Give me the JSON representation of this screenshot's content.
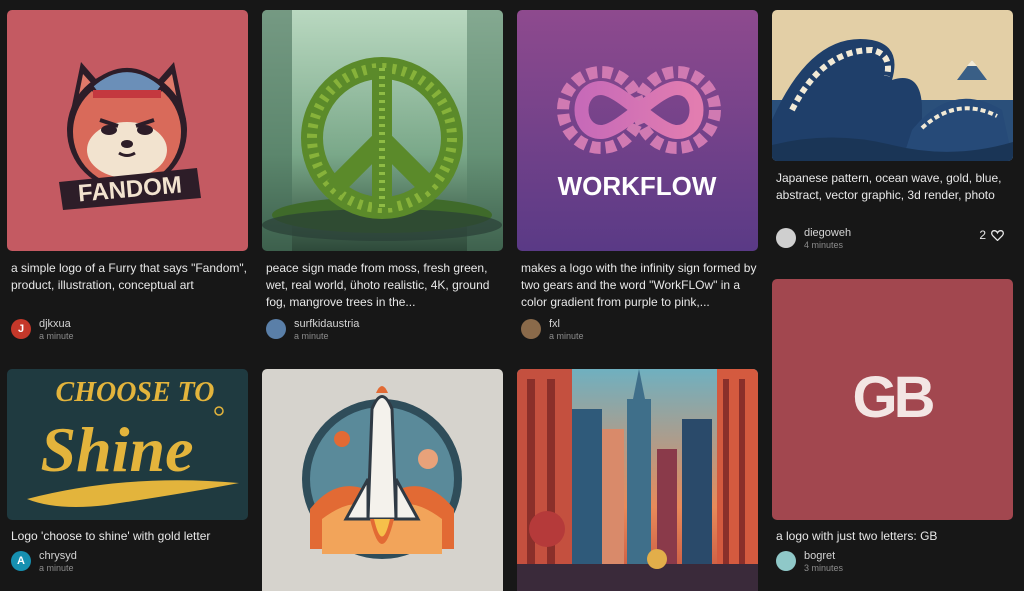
{
  "cards": [
    {
      "prompt": "a simple logo of a Furry that says \"Fandom\", product, illustration, conceptual art",
      "user": "djkxua",
      "time": "a minute",
      "avatar_letter": "",
      "image_text": "FANDOM"
    },
    {
      "prompt": "peace sign made from moss, fresh green, wet, real world, ühoto realistic, 4K, ground fog, mangrove trees in the...",
      "user": "surfkidaustria",
      "time": "a minute",
      "avatar_letter": ""
    },
    {
      "prompt": "makes a logo with the infinity sign formed by two gears and the word \"WorkFLOw\" in a color gradient from purple to pink,...",
      "user": "fxl",
      "time": "a minute",
      "avatar_letter": "",
      "image_text": "WORKFLOW"
    },
    {
      "prompt": "Japanese pattern, ocean wave, gold, blue, abstract, vector graphic, 3d render, photo",
      "user": "diegoweh",
      "time": "4 minutes",
      "avatar_letter": "",
      "likes": "2"
    },
    {
      "prompt": "Logo 'choose to shine' with gold letter",
      "user": "chrysyd",
      "time": "a minute",
      "avatar_letter": "A",
      "image_text_top": "CHOOSE TO",
      "image_text_main": "Shine"
    },
    {
      "prompt": "",
      "user": "",
      "time": "",
      "avatar_letter": ""
    },
    {
      "prompt": "",
      "user": "",
      "time": "",
      "avatar_letter": ""
    },
    {
      "prompt": "a logo with just two letters: GB",
      "user": "bogret",
      "time": "3 minutes",
      "avatar_letter": "",
      "image_text": "GB"
    }
  ],
  "colors": {
    "background": "#171717",
    "fandom_bg": "#c45a62",
    "workflow_bg": "#7a3f86",
    "gb_bg": "#a2474f",
    "shine_bg": "#1f3a40",
    "shine_gold": "#e3b43c"
  }
}
